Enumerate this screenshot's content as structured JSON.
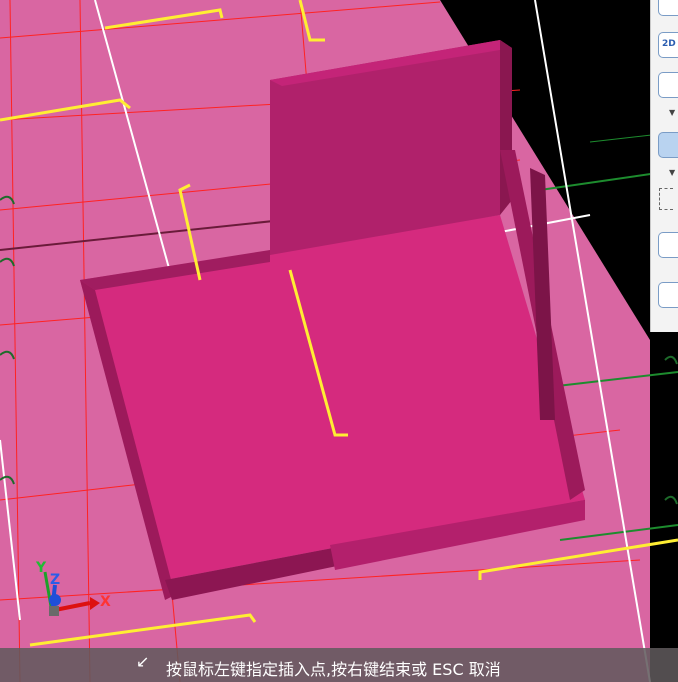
{
  "status_bar": {
    "message": "按鼠标左键指定插入点,按右键结束或 ESC 取消",
    "icon": "snap-cursor-icon"
  },
  "axis": {
    "x_label": "X",
    "y_label": "Y",
    "z_label": "Z"
  },
  "toolbar": {
    "view_2d_label": "2D",
    "buttons": [
      "view-cube-icon",
      "2d-view-icon",
      "box-view-icon",
      "box-3d-view-icon",
      "dashed-frame-icon",
      "cube-select-icon",
      "properties-icon"
    ]
  },
  "colors": {
    "floor": "#d966a2",
    "object_top": "#d52a7e",
    "object_side": "#9c1a5b",
    "background": "#000000",
    "red_line": "#ff2222",
    "yellow_line": "#ffee33",
    "green_line": "#1d8c2e",
    "white_line": "#ffffff"
  }
}
